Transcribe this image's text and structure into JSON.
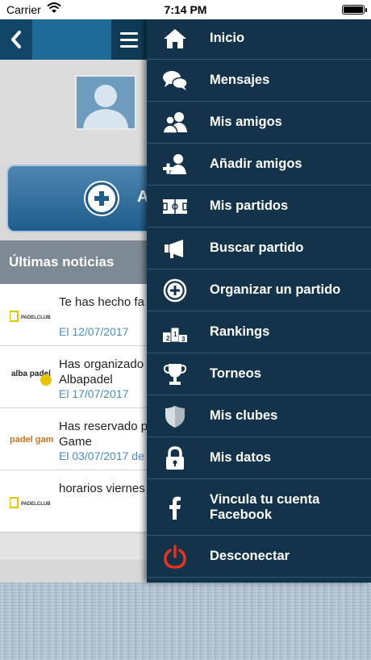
{
  "status_bar": {
    "carrier": "Carrier",
    "time": "7:14 PM"
  },
  "header": {
    "back_icon": "chevron-left-icon",
    "menu_icon": "hamburger-icon"
  },
  "main": {
    "action_button_label": "A",
    "news_header": "Últimas noticias",
    "news": [
      {
        "title": "Te has hecho fa",
        "date": "El 12/07/2017",
        "logo": "PADELCLUB"
      },
      {
        "title": "Has organizado Albapadel",
        "date": "El 17/07/2017",
        "logo": "alba padel"
      },
      {
        "title": "Has reservado p Game",
        "date": "El 03/07/2017 de",
        "logo": "padel game"
      },
      {
        "title": "horarios viernes",
        "date": "",
        "logo": "PADELCLUB"
      }
    ]
  },
  "drawer": {
    "items": [
      {
        "label": "Inicio",
        "icon": "home-icon"
      },
      {
        "label": "Mensajes",
        "icon": "chat-bubbles-icon"
      },
      {
        "label": "Mis amigos",
        "icon": "friends-icon"
      },
      {
        "label": "Añadir amigos",
        "icon": "add-friend-icon"
      },
      {
        "label": "Mis partidos",
        "icon": "court-icon"
      },
      {
        "label": "Buscar partido",
        "icon": "megaphone-icon"
      },
      {
        "label": "Organizar un partido",
        "icon": "plus-circle-icon"
      },
      {
        "label": "Rankings",
        "icon": "podium-icon"
      },
      {
        "label": "Torneos",
        "icon": "trophy-icon"
      },
      {
        "label": "Mis clubes",
        "icon": "shield-icon"
      },
      {
        "label": "Mis datos",
        "icon": "lock-icon"
      },
      {
        "label": "Vincula tu cuenta Facebook",
        "icon": "facebook-icon"
      },
      {
        "label": "Desconectar",
        "icon": "power-icon"
      }
    ]
  },
  "colors": {
    "drawer_bg": "#13334b",
    "header_blue": "#1e6b98",
    "date_blue": "#4a8cc0",
    "power_red": "#e8321e"
  }
}
